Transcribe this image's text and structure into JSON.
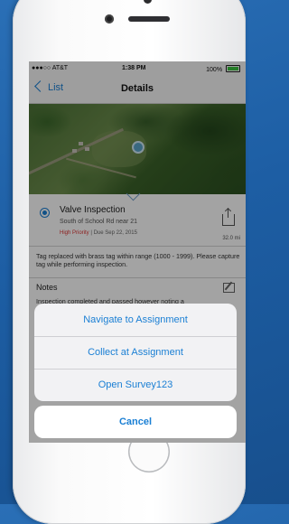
{
  "status_bar": {
    "carrier": "●●●○○ AT&T",
    "time": "1:38 PM",
    "battery": "100%"
  },
  "nav": {
    "back_label": "List",
    "title": "Details"
  },
  "assignment": {
    "title": "Valve Inspection",
    "location": "South of School Rd near 21",
    "priority": "High Priority",
    "due": "Due Sep 22, 2015",
    "distance": "32.0 mi",
    "description": "Tag replaced with brass tag within range (1000 - 1999). Please capture tag while performing inspection."
  },
  "notes": {
    "title": "Notes",
    "text": "Inspection completed and passed however noting a"
  },
  "action_sheet": {
    "items": [
      "Navigate to Assignment",
      "Collect at Assignment",
      "Open Survey123"
    ],
    "cancel": "Cancel"
  },
  "colors": {
    "accent": "#1a7fd4",
    "priority": "#dd3333",
    "background": "#1d5ea4"
  }
}
